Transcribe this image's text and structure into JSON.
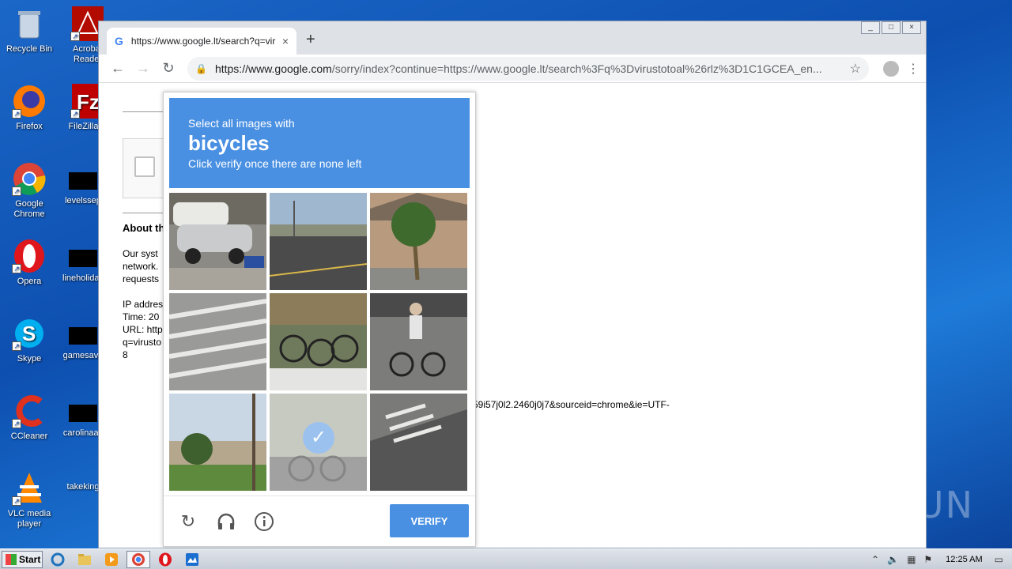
{
  "desktop": {
    "icons": [
      {
        "label": "Recycle Bin",
        "icon": "recycle-bin-icon"
      },
      {
        "label": "Acrobat Reader",
        "icon": "acrobat-icon"
      },
      {
        "label": "Firefox",
        "icon": "firefox-icon"
      },
      {
        "label": "FileZilla C",
        "icon": "filezilla-icon"
      },
      {
        "label": "Google Chrome",
        "icon": "chrome-icon"
      },
      {
        "label": "levelssep",
        "icon": "redacted-icon"
      },
      {
        "label": "Opera",
        "icon": "opera-icon"
      },
      {
        "label": "lineholiday",
        "icon": "redacted-icon"
      },
      {
        "label": "Skype",
        "icon": "skype-icon"
      },
      {
        "label": "gamesave",
        "icon": "redacted-icon"
      },
      {
        "label": "CCleaner",
        "icon": "ccleaner-icon"
      },
      {
        "label": "carolinaas",
        "icon": "redacted-icon"
      },
      {
        "label": "VLC media player",
        "icon": "vlc-icon"
      },
      {
        "label": "takeking",
        "icon": "redacted-icon"
      }
    ],
    "watermark": "ANY RUN"
  },
  "browser": {
    "tab_title": "https://www.google.lt/search?q=vir",
    "tab_close": "×",
    "new_tab": "+",
    "url_domain": "https://www.google.com",
    "url_rest": "/sorry/index?continue=https://www.google.lt/search%3Fq%3Dvirustotoal%26rlz%3D1C1GCEA_en...",
    "window_buttons": [
      "_",
      "□",
      "×"
    ]
  },
  "page": {
    "about_heading": "About th",
    "para1": [
      "Our syst",
      "network.",
      "requests"
    ],
    "para2": [
      "IP addres",
      "Time: 20",
      "URL: http",
      "q=virusto",
      "8"
    ],
    "url_tail": "59i57j0l2.2460j0j7&sourceid=chrome&ie=UTF-"
  },
  "captcha": {
    "instruction": "Select all images with",
    "object": "bicycles",
    "hint": "Click verify once there are none left",
    "verify_label": "VERIFY",
    "tiles": [
      {
        "scene": "parked-cars",
        "selected": false
      },
      {
        "scene": "street-road",
        "selected": false
      },
      {
        "scene": "palm-tree-house",
        "selected": false
      },
      {
        "scene": "crosswalk",
        "selected": false
      },
      {
        "scene": "bicycle-rack",
        "selected": false
      },
      {
        "scene": "cyclist",
        "selected": false
      },
      {
        "scene": "street-pole",
        "selected": false
      },
      {
        "scene": "bicycle-faded",
        "selected": true
      },
      {
        "scene": "sidewalk-crosswalk",
        "selected": false
      }
    ]
  },
  "taskbar": {
    "start_label": "Start",
    "clock": "12:25 AM"
  }
}
